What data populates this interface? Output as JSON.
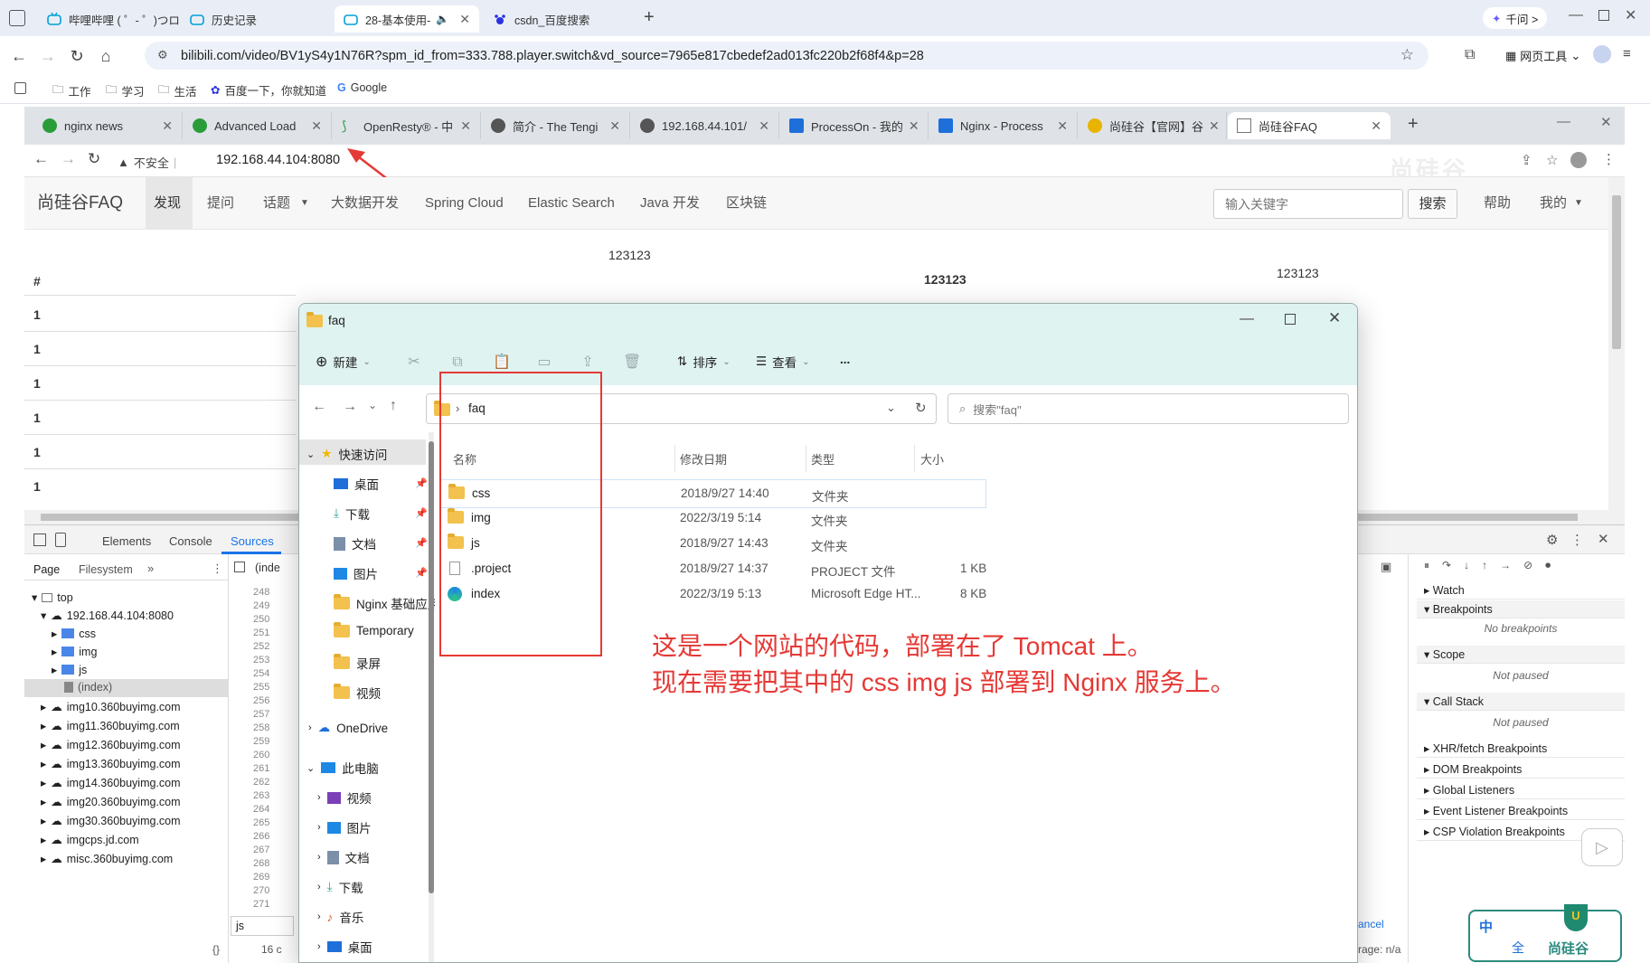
{
  "outer_browser": {
    "tabs": [
      {
        "label": "哔哩哔哩 ( ゜- ゜)つロ 干杯~"
      },
      {
        "label": "历史记录"
      },
      {
        "label": "28-基本使用-"
      },
      {
        "label": "csdn_百度搜索"
      }
    ],
    "qianwen_label": "千问 >",
    "url": "bilibili.com/video/BV1yS4y1N76R?spm_id_from=333.788.player.switch&vd_source=7965e817cbedef2ad013fc220b2f68f4&p=28",
    "web_tools_label": "网页工具",
    "bookmarks": [
      "工作",
      "学习",
      "生活",
      "百度一下，你就知道",
      "Google"
    ]
  },
  "inner_browser": {
    "tabs": [
      {
        "label": "nginx news"
      },
      {
        "label": "Advanced Load"
      },
      {
        "label": "OpenResty® - 中"
      },
      {
        "label": "简介 - The Tengi"
      },
      {
        "label": "192.168.44.101/"
      },
      {
        "label": "ProcessOn - 我的"
      },
      {
        "label": "Nginx - Process"
      },
      {
        "label": "尚硅谷【官网】谷"
      },
      {
        "label": "尚硅谷FAQ"
      }
    ],
    "insecure_label": "不安全",
    "url": "192.168.44.104:8080"
  },
  "site": {
    "brand": "尚硅谷FAQ",
    "nav": [
      "发现",
      "提问",
      "话题",
      "大数据开发",
      "Spring Cloud",
      "Elastic Search",
      "Java 开发",
      "区块链"
    ],
    "search_placeholder": "输入关键字",
    "search_button": "搜索",
    "help": "帮助",
    "mine": "我的",
    "header_hash": "#",
    "header_a": "123123",
    "header_b": "123123",
    "header_c": "123123",
    "rows": [
      "1",
      "1",
      "1",
      "1",
      "1",
      "1"
    ]
  },
  "devtools": {
    "tabs": [
      "Elements",
      "Console",
      "Sources"
    ],
    "sub_tabs": [
      "Page",
      "Filesystem"
    ],
    "tree": [
      "top",
      "192.168.44.104:8080",
      "css",
      "img",
      "js",
      "(index)",
      "img10.360buyimg.com",
      "img11.360buyimg.com",
      "img12.360buyimg.com",
      "img13.360buyimg.com",
      "img14.360buyimg.com",
      "img20.360buyimg.com",
      "img30.360buyimg.com",
      "imgcps.jd.com",
      "misc.360buyimg.com"
    ],
    "line_numbers": [
      "248",
      "249",
      "250",
      "251",
      "252",
      "253",
      "254",
      "255",
      "256",
      "257",
      "258",
      "259",
      "260",
      "261",
      "262",
      "263",
      "264",
      "265",
      "266",
      "267",
      "268",
      "269",
      "270",
      "271"
    ],
    "editor_tab": "(inde",
    "search_value": "js",
    "footer_text": "16 c",
    "right_panel": {
      "watch": "Watch",
      "breakpoints": "Breakpoints",
      "no_breakpoints": "No breakpoints",
      "scope": "Scope",
      "not_paused": "Not paused",
      "call_stack": "Call Stack",
      "xhr": "XHR/fetch Breakpoints",
      "dom": "DOM Breakpoints",
      "global": "Global Listeners",
      "event": "Event Listener Breakpoints",
      "csp": "CSP Violation Breakpoints"
    },
    "cancel_label": "ancel",
    "coverage_label": "rage: n/a"
  },
  "explorer": {
    "title": "faq",
    "toolbar": {
      "new": "新建",
      "sort": "排序",
      "view": "查看",
      "more": "..."
    },
    "breadcrumb": "faq",
    "search_placeholder": "搜索\"faq\"",
    "sidebar": [
      "快速访问",
      "桌面",
      "下载",
      "文档",
      "图片",
      "Nginx 基础应用",
      "Temporary",
      "录屏",
      "视频",
      "OneDrive",
      "此电脑",
      "视频",
      "图片",
      "文档",
      "下载",
      "音乐",
      "桌面"
    ],
    "columns": [
      "名称",
      "修改日期",
      "类型",
      "大小"
    ],
    "files": [
      {
        "name": "css",
        "date": "2018/9/27 14:40",
        "type": "文件夹",
        "size": ""
      },
      {
        "name": "img",
        "date": "2022/3/19 5:14",
        "type": "文件夹",
        "size": ""
      },
      {
        "name": "js",
        "date": "2018/9/27 14:43",
        "type": "文件夹",
        "size": ""
      },
      {
        "name": ".project",
        "date": "2018/9/27 14:37",
        "type": "PROJECT 文件",
        "size": "1 KB"
      },
      {
        "name": "index",
        "date": "2022/3/19 5:13",
        "type": "Microsoft Edge HT...",
        "size": "8 KB"
      }
    ]
  },
  "annotation": {
    "line1": "这是一个网站的代码，部署在了 Tomcat 上。",
    "line2": "现在需要把其中的 css img js 部署到 Nginx 服务上。",
    "color": "#e53935"
  },
  "watermark": {
    "brand": "尚硅谷"
  },
  "ime": {
    "label1": "中",
    "label2": "全"
  }
}
